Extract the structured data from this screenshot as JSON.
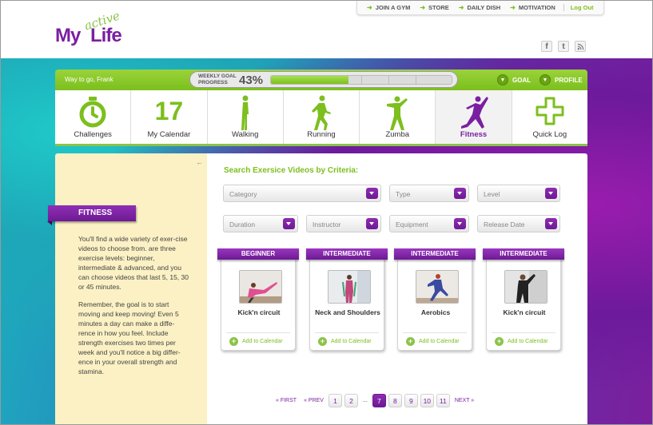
{
  "brand": {
    "prefix": "My",
    "accent": "active",
    "suffix": "Life"
  },
  "top_nav": [
    "JOIN A GYM",
    "STORE",
    "DAILY DISH",
    "MOTIVATION"
  ],
  "logout_label": "Log Out",
  "social": [
    "f",
    "t",
    "rss"
  ],
  "greeting": "Way to go, Frank",
  "weekly_goal": {
    "label": "WEEKLY GOAL PROGRESS",
    "percent_text": "43%",
    "percent": 43
  },
  "goal_button": "GOAL",
  "profile_button": "PROFILE",
  "tabs": [
    {
      "label": "Challenges",
      "icon": "stopwatch-icon"
    },
    {
      "label": "My Calendar",
      "number": "17"
    },
    {
      "label": "Walking",
      "icon": "walking-icon"
    },
    {
      "label": "Running",
      "icon": "running-icon"
    },
    {
      "label": "Zumba",
      "icon": "zumba-icon"
    },
    {
      "label": "Fitness",
      "icon": "fitness-icon",
      "active": true
    },
    {
      "label": "Quick Log",
      "icon": "plus-icon"
    }
  ],
  "side": {
    "heading": "FITNESS",
    "paragraphs": [
      "You'll find a wide variety of exer-cise videos to choose from. are three exercise levels: beginner, intermediate & advanced, and you can choose videos that last 5, 15, 30 or 45 minutes.",
      "Remember, the goal is to start moving and keep moving! Even 5 minutes a day can make a diffe-rence in how you feel.  Include strength exercises two times per week and you'll notice a big differ-ence in your overall strength and stamina."
    ]
  },
  "search": {
    "title": "Search Exersice Videos by Criteria:",
    "filters": [
      "Category",
      "Type",
      "Level",
      "Duration",
      "Instructor",
      "Equipment",
      "Release Date"
    ]
  },
  "videos": [
    {
      "level": "BEGINNER",
      "title": "Kick'n circuit",
      "add_label": "Add to Calendar"
    },
    {
      "level": "INTERMEDIATE",
      "title": "Neck and Shoulders",
      "add_label": "Add to Calendar"
    },
    {
      "level": "INTERMEDIATE",
      "title": "Aerobics",
      "add_label": "Add to Calendar"
    },
    {
      "level": "INTERMEDIATE",
      "title": "Kick'n circuit",
      "add_label": "Add to Calendar"
    }
  ],
  "pagination": {
    "first": "« FIRST",
    "prev": "« PREV",
    "next": "NEXT »",
    "ellipsis": "...",
    "pages_before": [
      "1",
      "2"
    ],
    "pages_after": [
      "7",
      "8",
      "9",
      "10",
      "11"
    ],
    "current": "7"
  },
  "colors": {
    "green": "#7cbf1e",
    "purple": "#7b1fa2"
  }
}
